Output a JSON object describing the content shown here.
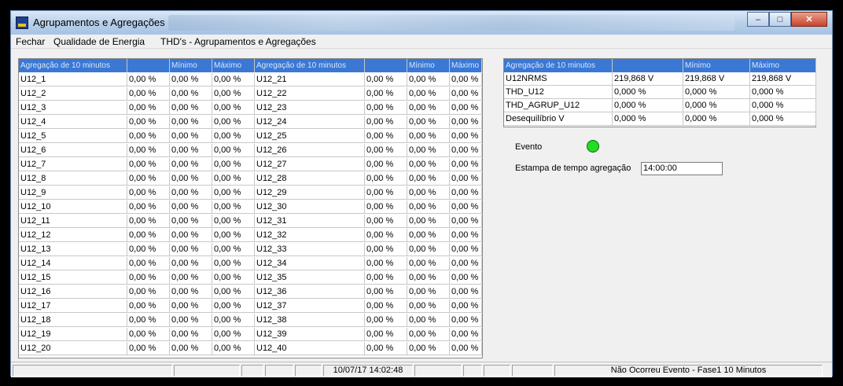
{
  "window": {
    "title": "Agrupamentos e Agregações"
  },
  "menu": [
    "Fechar",
    "Qualidade de Energia",
    "THD's - Agrupamentos e Agregações"
  ],
  "left_table": {
    "headers": [
      "Agregação de 10 minutos",
      "",
      "Mínimo",
      "Máximo",
      "Agregação de 10 minutos",
      "",
      "Mínimo",
      "Máximo"
    ],
    "rows": [
      [
        "U12_1",
        "0,00 %",
        "0,00 %",
        "0,00 %",
        "U12_21",
        "0,00 %",
        "0,00 %",
        "0,00 %"
      ],
      [
        "U12_2",
        "0,00 %",
        "0,00 %",
        "0,00 %",
        "U12_22",
        "0,00 %",
        "0,00 %",
        "0,00 %"
      ],
      [
        "U12_3",
        "0,00 %",
        "0,00 %",
        "0,00 %",
        "U12_23",
        "0,00 %",
        "0,00 %",
        "0,00 %"
      ],
      [
        "U12_4",
        "0,00 %",
        "0,00 %",
        "0,00 %",
        "U12_24",
        "0,00 %",
        "0,00 %",
        "0,00 %"
      ],
      [
        "U12_5",
        "0,00 %",
        "0,00 %",
        "0,00 %",
        "U12_25",
        "0,00 %",
        "0,00 %",
        "0,00 %"
      ],
      [
        "U12_6",
        "0,00 %",
        "0,00 %",
        "0,00 %",
        "U12_26",
        "0,00 %",
        "0,00 %",
        "0,00 %"
      ],
      [
        "U12_7",
        "0,00 %",
        "0,00 %",
        "0,00 %",
        "U12_27",
        "0,00 %",
        "0,00 %",
        "0,00 %"
      ],
      [
        "U12_8",
        "0,00 %",
        "0,00 %",
        "0,00 %",
        "U12_28",
        "0,00 %",
        "0,00 %",
        "0,00 %"
      ],
      [
        "U12_9",
        "0,00 %",
        "0,00 %",
        "0,00 %",
        "U12_29",
        "0,00 %",
        "0,00 %",
        "0,00 %"
      ],
      [
        "U12_10",
        "0,00 %",
        "0,00 %",
        "0,00 %",
        "U12_30",
        "0,00 %",
        "0,00 %",
        "0,00 %"
      ],
      [
        "U12_11",
        "0,00 %",
        "0,00 %",
        "0,00 %",
        "U12_31",
        "0,00 %",
        "0,00 %",
        "0,00 %"
      ],
      [
        "U12_12",
        "0,00 %",
        "0,00 %",
        "0,00 %",
        "U12_32",
        "0,00 %",
        "0,00 %",
        "0,00 %"
      ],
      [
        "U12_13",
        "0,00 %",
        "0,00 %",
        "0,00 %",
        "U12_33",
        "0,00 %",
        "0,00 %",
        "0,00 %"
      ],
      [
        "U12_14",
        "0,00 %",
        "0,00 %",
        "0,00 %",
        "U12_34",
        "0,00 %",
        "0,00 %",
        "0,00 %"
      ],
      [
        "U12_15",
        "0,00 %",
        "0,00 %",
        "0,00 %",
        "U12_35",
        "0,00 %",
        "0,00 %",
        "0,00 %"
      ],
      [
        "U12_16",
        "0,00 %",
        "0,00 %",
        "0,00 %",
        "U12_36",
        "0,00 %",
        "0,00 %",
        "0,00 %"
      ],
      [
        "U12_17",
        "0,00 %",
        "0,00 %",
        "0,00 %",
        "U12_37",
        "0,00 %",
        "0,00 %",
        "0,00 %"
      ],
      [
        "U12_18",
        "0,00 %",
        "0,00 %",
        "0,00 %",
        "U12_38",
        "0,00 %",
        "0,00 %",
        "0,00 %"
      ],
      [
        "U12_19",
        "0,00 %",
        "0,00 %",
        "0,00 %",
        "U12_39",
        "0,00 %",
        "0,00 %",
        "0,00 %"
      ],
      [
        "U12_20",
        "0,00 %",
        "0,00 %",
        "0,00 %",
        "U12_40",
        "0,00 %",
        "0,00 %",
        "0,00 %"
      ]
    ]
  },
  "right_table": {
    "headers": [
      "Agregação de 10 minutos",
      "",
      "Mínimo",
      "Máximo"
    ],
    "rows": [
      [
        "U12NRMS",
        "219,868 V",
        "219,868 V",
        "219,868 V"
      ],
      [
        "THD_U12",
        "0,000 %",
        "0,000 %",
        "0,000 %"
      ],
      [
        "THD_AGRUP_U12",
        "0,000 %",
        "0,000 %",
        "0,000 %"
      ],
      [
        "Desequilíbrio V",
        "0,000 %",
        "0,000 %",
        "0,000 %"
      ]
    ]
  },
  "evento": {
    "label": "Evento",
    "indicator_color": "#22dd22"
  },
  "estampa": {
    "label": "Estampa de tempo agregação",
    "value": "14:00:00"
  },
  "status": {
    "datetime": "10/07/17 14:02:48",
    "message": "Não Ocorreu Evento - Fase1 10 Minutos"
  }
}
